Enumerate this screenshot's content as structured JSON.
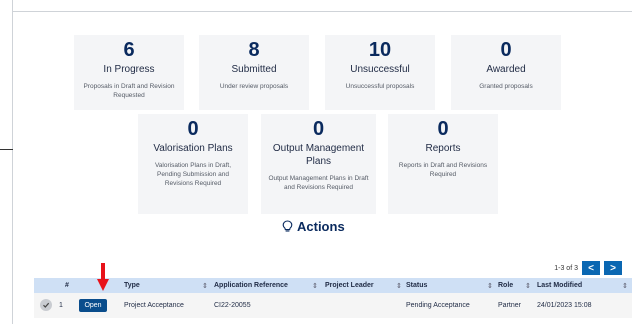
{
  "cards_row1": [
    {
      "count": "6",
      "title": "In Progress",
      "desc": "Proposals in Draft and Revision Requested"
    },
    {
      "count": "8",
      "title": "Submitted",
      "desc": "Under review proposals"
    },
    {
      "count": "10",
      "title": "Unsuccessful",
      "desc": "Unsuccessful proposals"
    },
    {
      "count": "0",
      "title": "Awarded",
      "desc": "Granted proposals"
    }
  ],
  "cards_row2": [
    {
      "count": "0",
      "title": "Valorisation Plans",
      "desc": "Valorisation Plans in Draft, Pending Submission and Revisions Required"
    },
    {
      "count": "0",
      "title": "Output Management Plans",
      "desc": "Output Management Plans in Draft and Revisions Required"
    },
    {
      "count": "0",
      "title": "Reports",
      "desc": "Reports in Draft and Revisions Required"
    }
  ],
  "actions": {
    "heading": "Actions",
    "icon": "lightbulb-icon",
    "pagination": {
      "range": "1-3 of 3",
      "prev": "<",
      "next": ">"
    },
    "columns": [
      "#",
      "Type",
      "Application Reference",
      "Project Leader",
      "Status",
      "Role",
      "Last Modified"
    ],
    "rows": [
      {
        "index": "1",
        "button": "Open",
        "type": "Project Acceptance",
        "reference": "CI22-20055",
        "leader": "",
        "status": "Pending Acceptance",
        "role": "Partner",
        "modified": "24/01/2023 15:08"
      }
    ]
  },
  "colors": {
    "accent": "#0a4d8c",
    "header_bg": "#cfe0f5",
    "arrow": "#e8121a"
  }
}
